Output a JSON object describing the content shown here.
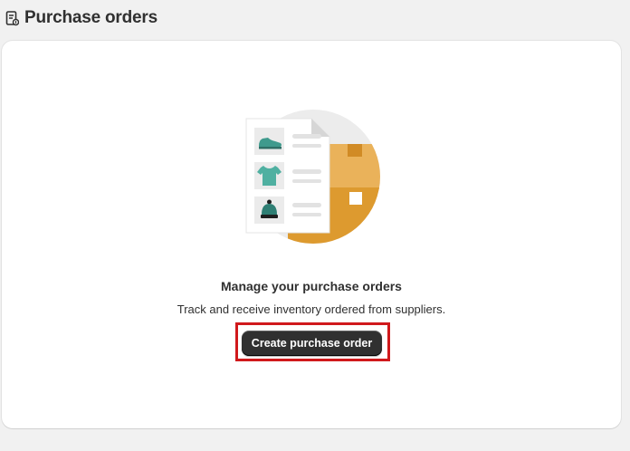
{
  "header": {
    "title": "Purchase orders",
    "icon": "purchase-order-icon"
  },
  "empty_state": {
    "illustration": "purchase-orders-illustration",
    "title": "Manage your purchase orders",
    "description": "Track and receive inventory ordered from suppliers.",
    "cta_label": "Create purchase order"
  },
  "colors": {
    "background": "#f1f1f1",
    "card": "#ffffff",
    "text": "#303030",
    "button": "#303030",
    "highlight": "#d0191c",
    "box_orange": "#e8a33d",
    "item_teal": "#4aa89a"
  }
}
